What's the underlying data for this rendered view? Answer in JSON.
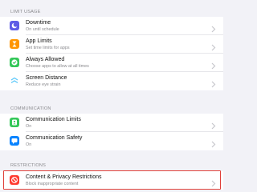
{
  "sections": {
    "limit_usage": {
      "header": "LIMIT USAGE",
      "items": [
        {
          "title": "Downtime",
          "subtitle": "On until schedule",
          "icon": "moon-icon",
          "color": "#5e5ce6"
        },
        {
          "title": "App Limits",
          "subtitle": "Set time limits for apps",
          "icon": "hourglass-icon",
          "color": "#ff9500"
        },
        {
          "title": "Always Allowed",
          "subtitle": "Choose apps to allow at all times",
          "icon": "checkmark-icon",
          "color": "#34c759"
        },
        {
          "title": "Screen Distance",
          "subtitle": "Reduce eye strain",
          "icon": "screen-distance-icon",
          "color": "#5ac8fa"
        }
      ]
    },
    "communication": {
      "header": "COMMUNICATION",
      "items": [
        {
          "title": "Communication Limits",
          "subtitle": "On",
          "icon": "person-bubble-icon",
          "color": "#34c759"
        },
        {
          "title": "Communication Safety",
          "subtitle": "On",
          "icon": "chat-bubble-icon",
          "color": "#0a84ff"
        }
      ]
    },
    "restrictions": {
      "header": "RESTRICTIONS",
      "items": [
        {
          "title": "Content & Privacy Restrictions",
          "subtitle": "Block inappropriate content",
          "icon": "no-entry-icon",
          "color": "#ff3b30",
          "highlighted": true
        }
      ]
    }
  },
  "colors": {
    "highlight_border": "#e0403a",
    "background": "#f2f2f7",
    "chevron": "#c7c7cc"
  }
}
